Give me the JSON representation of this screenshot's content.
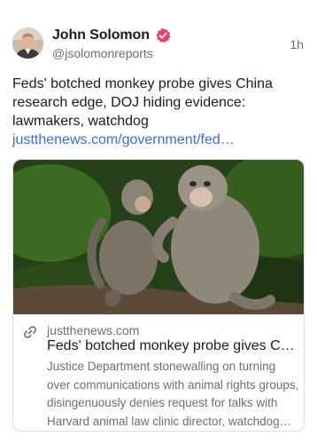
{
  "author": {
    "display_name": "John Solomon",
    "handle": "@jsolomonreports",
    "verified_icon": "verified-badge-icon",
    "badge_color": "#e8436b"
  },
  "timestamp": "1h",
  "post": {
    "text": "Feds' botched monkey probe gives China research edge, DOJ hiding evidence: lawmakers, watchdog ",
    "link_text": "justthenews.com/government/fed…",
    "link_color": "#3b6fd4"
  },
  "link_card": {
    "icon": "link-icon",
    "domain": "justthenews.com",
    "title": "Feds' botched monkey probe gives China research edge, DOJ hiding evidence",
    "description": "Justice Department stonewalling on turning over communications with animal rights groups, disingenuously denies request for talks with Harvard animal law clinic director, watchdog says."
  }
}
